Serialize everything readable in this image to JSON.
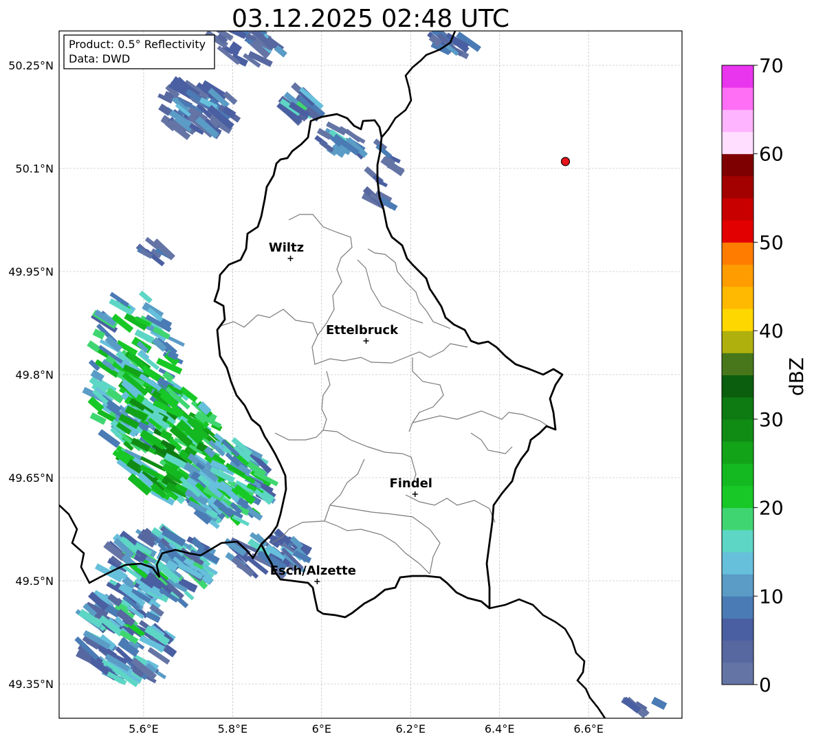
{
  "title": "03.12.2025 02:48 UTC",
  "info_box": {
    "product": "Product: 0.5° Reflectivity",
    "source": "Data: DWD"
  },
  "axes": {
    "lon_min": 5.41,
    "lon_max": 6.81,
    "lat_min": 49.3,
    "lat_max": 50.3,
    "lon_ticks": [
      {
        "v": 5.6,
        "label": "5.6°E"
      },
      {
        "v": 5.8,
        "label": "5.8°E"
      },
      {
        "v": 6.0,
        "label": "6°E"
      },
      {
        "v": 6.2,
        "label": "6.2°E"
      },
      {
        "v": 6.4,
        "label": "6.4°E"
      },
      {
        "v": 6.6,
        "label": "6.6°E"
      }
    ],
    "lat_ticks": [
      {
        "v": 50.25,
        "label": "50.25°N"
      },
      {
        "v": 50.1,
        "label": "50.1°N"
      },
      {
        "v": 49.95,
        "label": "49.95°N"
      },
      {
        "v": 49.8,
        "label": "49.8°N"
      },
      {
        "v": 49.65,
        "label": "49.65°N"
      },
      {
        "v": 49.5,
        "label": "49.5°N"
      },
      {
        "v": 49.35,
        "label": "49.35°N"
      }
    ],
    "grid": true
  },
  "cities": [
    {
      "name": "Wiltz",
      "lon": 5.93,
      "lat": 49.969
    },
    {
      "name": "Ettelbruck",
      "lon": 6.1,
      "lat": 49.849
    },
    {
      "name": "Findel",
      "lon": 6.21,
      "lat": 49.626
    },
    {
      "name": "Esch/Alzette",
      "lon": 5.99,
      "lat": 49.499
    }
  ],
  "radar_site": {
    "lon": 6.548,
    "lat": 50.11,
    "color": "#e8141c"
  },
  "colorbar": {
    "label": "dBZ",
    "min": 0,
    "max": 70,
    "ticks": [
      "0",
      "10",
      "20",
      "30",
      "40",
      "50",
      "60",
      "70"
    ],
    "colors": [
      "#6474a5",
      "#5768a0",
      "#4a5fa1",
      "#4a7bb4",
      "#5a9cc6",
      "#66bfdb",
      "#5dd6c5",
      "#3fd671",
      "#17c826",
      "#14b820",
      "#12a318",
      "#108c15",
      "#0d7a12",
      "#0b5e0e",
      "#47771a",
      "#afb00d",
      "#ffd700",
      "#ffb900",
      "#ff9c00",
      "#ff7c00",
      "#e30000",
      "#c90000",
      "#a30000",
      "#7f0000",
      "#ffdeff",
      "#ffb4ff",
      "#ff6ff5",
      "#ea35ef"
    ]
  },
  "rain_cells": [
    {
      "lon": 5.72,
      "lat": 50.185,
      "r": 0.09,
      "rlat": 0.035,
      "dbz": 8,
      "n": 60
    },
    {
      "lon": 5.84,
      "lat": 50.285,
      "r": 0.08,
      "rlat": 0.03,
      "dbz": 9,
      "n": 30
    },
    {
      "lon": 5.95,
      "lat": 50.19,
      "r": 0.05,
      "rlat": 0.02,
      "dbz": 11,
      "n": 16
    },
    {
      "lon": 6.04,
      "lat": 50.14,
      "r": 0.05,
      "rlat": 0.02,
      "dbz": 10,
      "n": 18
    },
    {
      "lon": 6.14,
      "lat": 50.08,
      "r": 0.03,
      "rlat": 0.06,
      "dbz": 6,
      "n": 14
    },
    {
      "lon": 5.62,
      "lat": 49.98,
      "r": 0.03,
      "rlat": 0.01,
      "dbz": 7,
      "n": 8
    },
    {
      "lon": 5.58,
      "lat": 49.8,
      "r": 0.1,
      "rlat": 0.12,
      "dbz": 20,
      "n": 140
    },
    {
      "lon": 5.66,
      "lat": 49.7,
      "r": 0.11,
      "rlat": 0.08,
      "dbz": 26,
      "n": 140
    },
    {
      "lon": 5.79,
      "lat": 49.64,
      "r": 0.09,
      "rlat": 0.06,
      "dbz": 19,
      "n": 110
    },
    {
      "lon": 5.64,
      "lat": 49.52,
      "r": 0.12,
      "rlat": 0.05,
      "dbz": 15,
      "n": 120
    },
    {
      "lon": 5.56,
      "lat": 49.42,
      "r": 0.1,
      "rlat": 0.07,
      "dbz": 14,
      "n": 110
    },
    {
      "lon": 5.88,
      "lat": 49.54,
      "r": 0.08,
      "rlat": 0.03,
      "dbz": 11,
      "n": 50
    },
    {
      "lon": 6.28,
      "lat": 50.28,
      "r": 0.06,
      "rlat": 0.015,
      "dbz": 7,
      "n": 14
    },
    {
      "lon": 6.73,
      "lat": 49.32,
      "r": 0.04,
      "rlat": 0.01,
      "dbz": 6,
      "n": 6
    }
  ]
}
